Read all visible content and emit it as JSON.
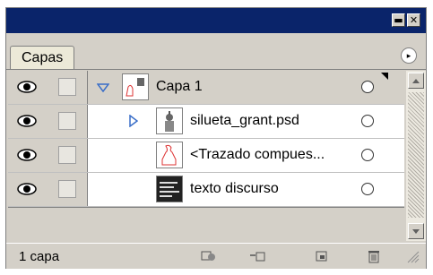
{
  "window": {
    "minimize_glyph": "▬",
    "close_glyph": "✕"
  },
  "panel": {
    "tab_label": "Capas",
    "menu_glyph": "▸"
  },
  "layers": [
    {
      "name": "Capa 1",
      "kind": "layer",
      "expanded": true,
      "selected": true
    },
    {
      "name": "silueta_grant.psd",
      "kind": "item",
      "expanded": false
    },
    {
      "name": "<Trazado compues...",
      "kind": "item"
    },
    {
      "name": "texto discurso",
      "kind": "item"
    }
  ],
  "footer": {
    "status": "1 capa"
  },
  "colors": {
    "title_bar": "#0a246a",
    "expand_triangle": "#3a6ec8",
    "panel_bg": "#d4d0c8"
  }
}
